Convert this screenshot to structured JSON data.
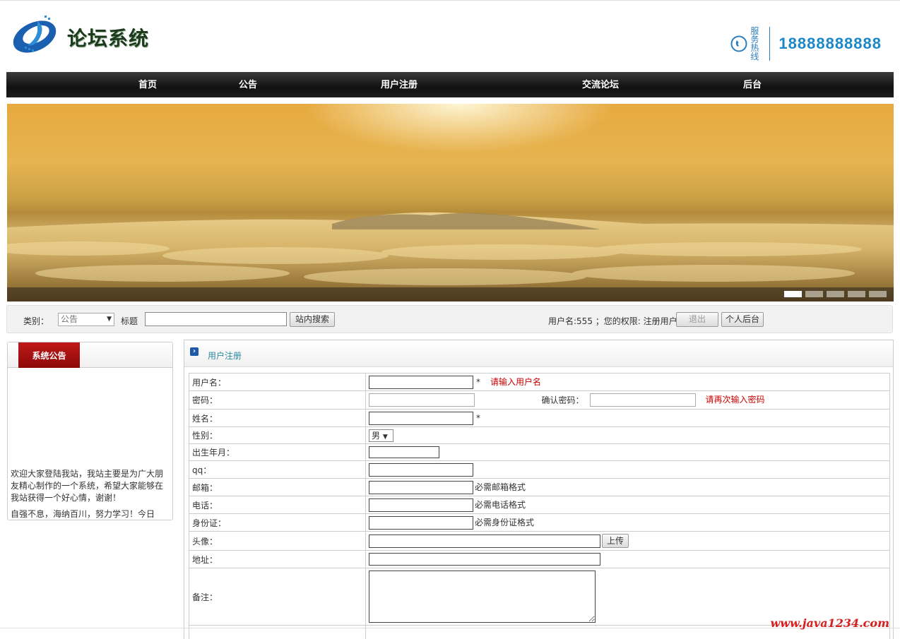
{
  "header": {
    "site_title": "论坛系统",
    "hotline_label": "服务热线",
    "hotline_number": "18888888888",
    "colors": {
      "nav_bg": "#1a1a1a",
      "accent": "#1b86c8"
    }
  },
  "nav": {
    "items": [
      "首页",
      "公告",
      "用户注册",
      "交流论坛",
      "后台"
    ]
  },
  "banner": {
    "slides": 5,
    "active_slide": 1
  },
  "search": {
    "category_label": "类别：",
    "category_value": "公告",
    "title_label": "标题",
    "title_value": "",
    "search_button": "站内搜索",
    "user_info": "用户名:555 ；您的权限: 注册用户",
    "logout_button": "退出",
    "personal_button": "个人后台"
  },
  "sidebar": {
    "tab": "系统公告",
    "paragraphs": [
      "欢迎大家登陆我站，我站主要是为广大朋友精心制作的一个系统，希望大家能够在我站获得一个好心情，谢谢！",
      "自强不息，海纳百川，努力学习！今日事..."
    ]
  },
  "main": {
    "title": "用户注册",
    "form": {
      "username_label": "用户名：",
      "username_hint": "请输入用户名",
      "required_mark": "*",
      "password_label": "密码：",
      "confirm_label": "确认密码：",
      "confirm_hint": "请再次输入密码",
      "name_label": "姓名：",
      "gender_label": "性别：",
      "gender_value": "男",
      "birth_label": "出生年月：",
      "qq_label": "qq：",
      "email_label": "邮箱：",
      "email_hint": "必需邮箱格式",
      "phone_label": "电话：",
      "phone_hint": "必需电话格式",
      "idcard_label": "身份证：",
      "idcard_hint": "必需身份证格式",
      "avatar_label": "头像：",
      "upload_button": "上传",
      "address_label": "地址：",
      "note_label": "备注："
    }
  },
  "watermark": "www.java1234.com"
}
